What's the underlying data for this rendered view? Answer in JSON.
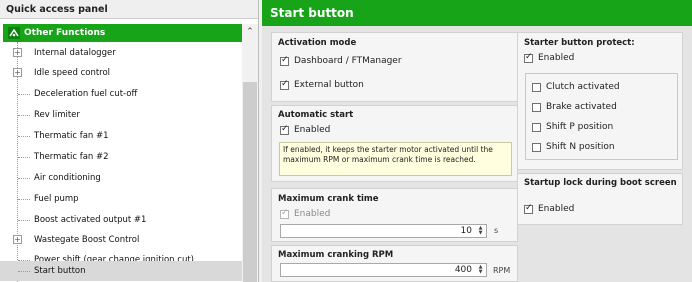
{
  "sidebar": {
    "title": "Quick access panel",
    "group": "Other Functions",
    "items": [
      {
        "label": "Internal datalogger",
        "expandable": true
      },
      {
        "label": "Idle speed control",
        "expandable": true
      },
      {
        "label": "Deceleration fuel cut-off",
        "expandable": false
      },
      {
        "label": "Rev limiter",
        "expandable": false
      },
      {
        "label": "Thermatic fan #1",
        "expandable": false
      },
      {
        "label": "Thermatic fan #2",
        "expandable": false
      },
      {
        "label": "Air conditioning",
        "expandable": false
      },
      {
        "label": "Fuel pump",
        "expandable": false
      },
      {
        "label": "Boost activated output #1",
        "expandable": false
      },
      {
        "label": "Wastegate Boost Control",
        "expandable": true
      },
      {
        "label": "Power shift (gear change ignition cut)",
        "expandable": false
      },
      {
        "label": "Start button",
        "expandable": false,
        "selected": true
      }
    ]
  },
  "main": {
    "title": "Start button",
    "activation": {
      "title": "Activation mode",
      "dashboard": "Dashboard / FTManager",
      "dashboard_checked": true,
      "external": "External button",
      "external_checked": true
    },
    "auto_start": {
      "title": "Automatic start",
      "enabled": "Enabled",
      "enabled_checked": true,
      "info": "If enabled, it keeps the starter motor activated until the maximum RPM or maximum crank time is reached."
    },
    "crank_time": {
      "title": "Maximum crank time",
      "enabled": "Enabled",
      "enabled_checked": true,
      "value": "10",
      "unit": "s"
    },
    "crank_rpm": {
      "title": "Maximum cranking RPM",
      "value": "400",
      "unit": "RPM"
    },
    "protect": {
      "title": "Starter button protect:",
      "enabled": "Enabled",
      "enabled_checked": true,
      "options": [
        {
          "label": "Clutch activated",
          "checked": false
        },
        {
          "label": "Brake activated",
          "checked": false
        },
        {
          "label": "Shift P position",
          "checked": false
        },
        {
          "label": "Shift N position",
          "checked": false
        }
      ]
    },
    "boot_lock": {
      "title": "Startup lock during boot screen",
      "enabled": "Enabled",
      "enabled_checked": true
    }
  },
  "colors": {
    "accent": "#18a418",
    "info_bg": "#ffffe0",
    "selected_row": "#d9d9d9"
  }
}
